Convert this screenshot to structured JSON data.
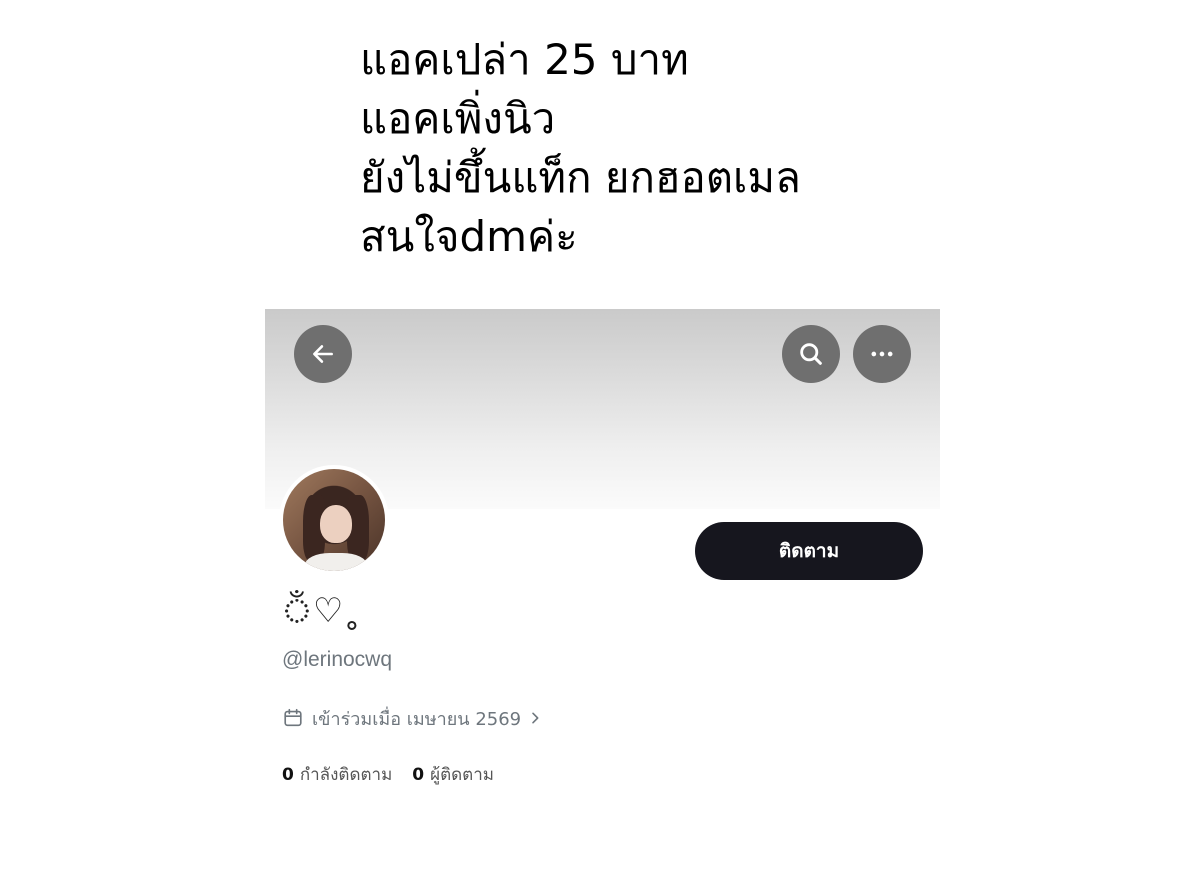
{
  "caption": {
    "lines": [
      "แอคเปล่า 25 บาท",
      "แอคเพิ่งนิว",
      "ยังไม่ขึ้นแท็ก ยกฮอตเมล",
      "สนใจdmค่ะ"
    ]
  },
  "profile": {
    "display_name": "ঁ♡˳",
    "handle": "@lerinocwq",
    "joined": "เข้าร่วมเมื่อ เมษายน 2569",
    "follow_label": "ติดตาม",
    "following_count": "0",
    "following_label": "กำลังติดตาม",
    "followers_count": "0",
    "followers_label": "ผู้ติดตาม"
  },
  "icons": {
    "back": "arrow-left-icon",
    "search": "search-icon",
    "more": "more-horizontal-icon",
    "calendar": "calendar-icon",
    "chevron": "chevron-right-icon"
  },
  "colors": {
    "follow_button": "#16161e",
    "icon_button": "#6f6f6f",
    "muted_text": "#6e767d"
  }
}
